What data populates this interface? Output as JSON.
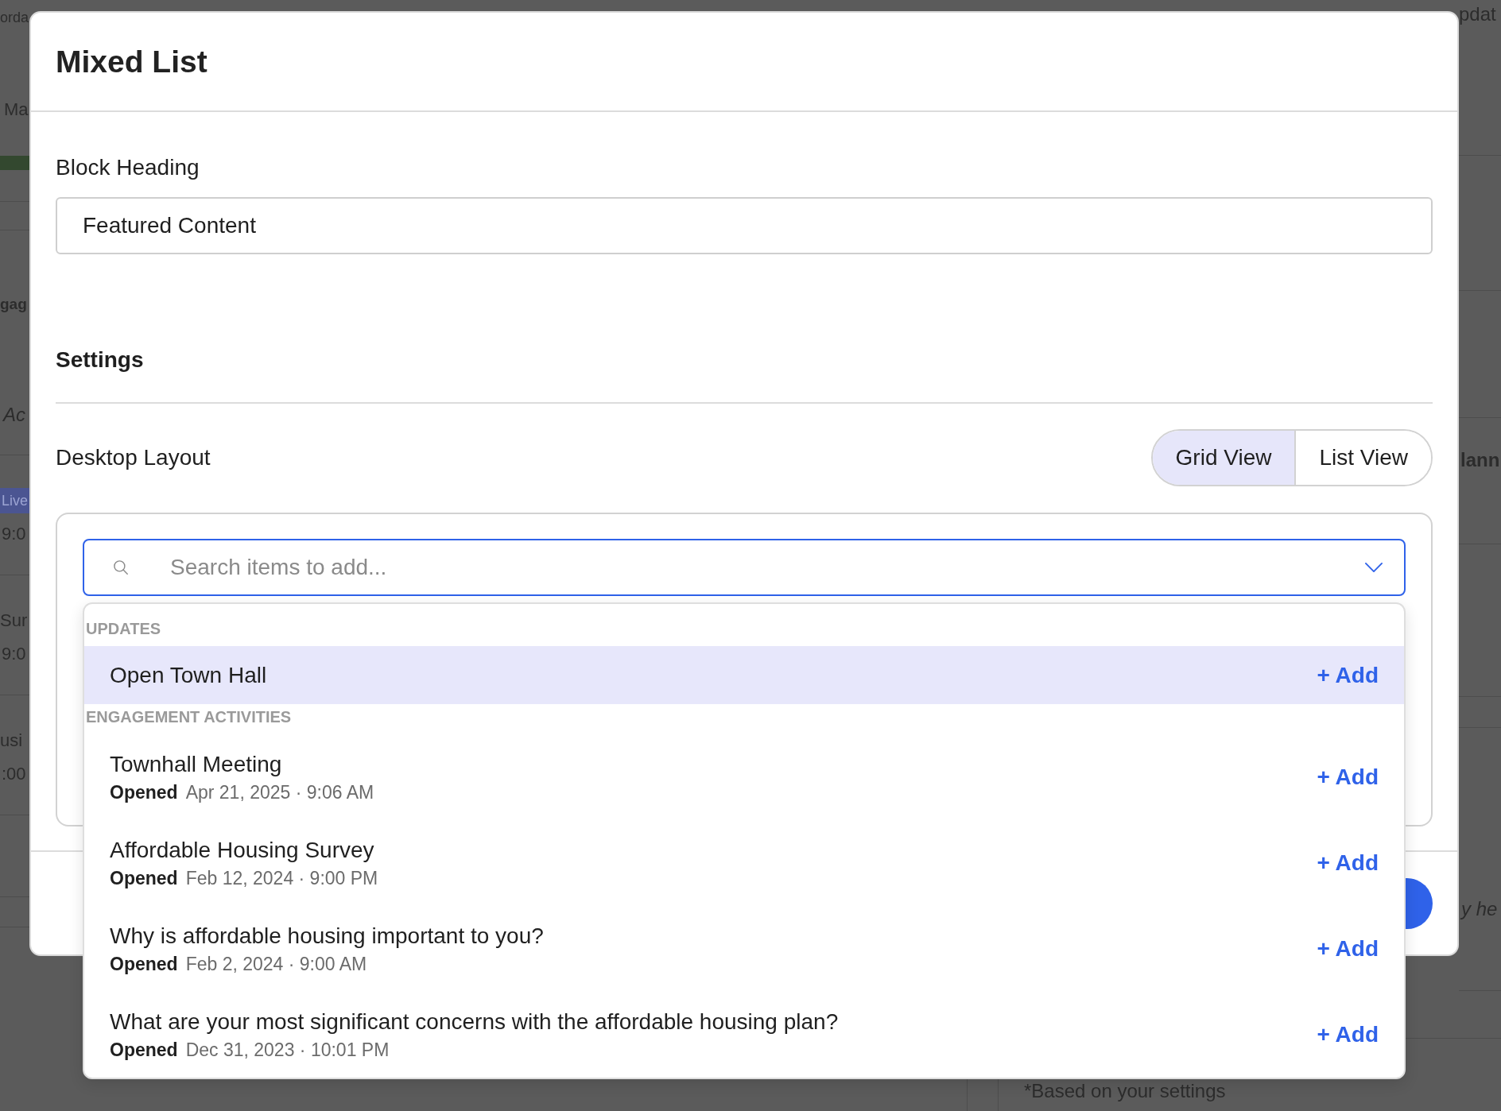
{
  "background": {
    "top_left_text": "orda",
    "top_right_text": "pdat",
    "left_tab": "Ma",
    "left_heading": "gag",
    "left_note": "Ac",
    "left_items": [
      {
        "kind": "badge",
        "label": "Live",
        "time": "9:0"
      },
      {
        "kind": "title",
        "label": "Sur",
        "time": "9:0"
      },
      {
        "kind": "title",
        "label": "usi",
        "time": ":00"
      }
    ],
    "right_heading": "lann",
    "right_note": "y he",
    "footnote": "*Based on your settings"
  },
  "modal": {
    "title": "Mixed List",
    "block_heading": {
      "label": "Block Heading",
      "value": "Featured Content"
    },
    "settings": {
      "heading": "Settings",
      "desktop_layout": {
        "label": "Desktop Layout",
        "options": [
          {
            "label": "Grid View",
            "selected": true
          },
          {
            "label": "List View",
            "selected": false
          }
        ]
      }
    },
    "search": {
      "placeholder": "Search items to add..."
    },
    "dropdown": {
      "groups": [
        {
          "heading": "UPDATES",
          "items": [
            {
              "title": "Open Town Hall",
              "action": "+ Add",
              "selected": true
            }
          ]
        },
        {
          "heading": "ENGAGEMENT ACTIVITIES",
          "items": [
            {
              "title": "Townhall Meeting",
              "status": "Opened",
              "date": "Apr 21, 2025 · 9:06 AM",
              "action": "+ Add",
              "selected": false
            },
            {
              "title": "Affordable Housing Survey",
              "status": "Opened",
              "date": "Feb 12, 2024 · 9:00 PM",
              "action": "+ Add",
              "selected": false
            },
            {
              "title": "Why is affordable housing important to you?",
              "status": "Opened",
              "date": "Feb 2, 2024 · 9:00 AM",
              "action": "+ Add",
              "selected": false
            },
            {
              "title": "What are your most significant concerns with the affordable housing plan?",
              "status": "Opened",
              "date": "Dec 31, 2023 · 10:01 PM",
              "action": "+ Add",
              "selected": false
            }
          ]
        }
      ]
    }
  }
}
